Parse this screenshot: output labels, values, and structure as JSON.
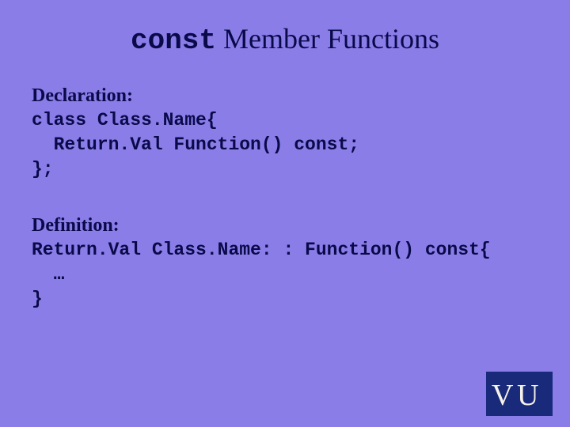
{
  "title": {
    "keyword": "const",
    "rest": " Member Functions"
  },
  "sections": {
    "declaration": {
      "label": "Declaration:",
      "code": "class Class.Name{\n  Return.Val Function() const;\n};"
    },
    "definition": {
      "label": "Definition:",
      "code": "Return.Val Class.Name: : Function() const{\n  …\n}"
    }
  },
  "logo": {
    "text": "VU"
  }
}
